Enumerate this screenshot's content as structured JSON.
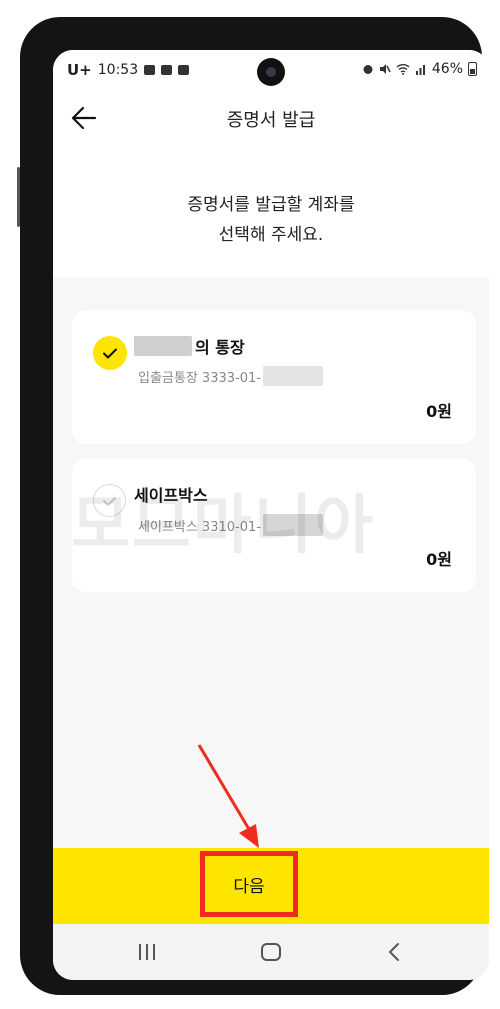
{
  "status_bar": {
    "carrier": "U+",
    "time": "10:53",
    "battery": "46%",
    "left_icons": [
      "gallery-icon",
      "message-icon",
      "message-icon"
    ],
    "right_icons": [
      "alarm-icon",
      "mute-icon",
      "wifi-icon",
      "signal-icon",
      "battery-icon"
    ]
  },
  "header": {
    "title": "증명서 발급",
    "back_icon": "arrow-left-icon"
  },
  "instruction": {
    "line1": "증명서를 발급할 계좌를",
    "line2": "선택해 주세요."
  },
  "accounts": [
    {
      "name_suffix": "의 통장",
      "account_prefix": "입출금통장 3333-01-",
      "balance": "0원",
      "selected": true
    },
    {
      "name": "세이프박스",
      "account_prefix": "세이프박스 3310-01-",
      "balance": "0원",
      "selected": false
    }
  ],
  "watermark": "모므마니아",
  "next_button": {
    "label": "다음"
  },
  "annotation": {
    "color": "#ee2b1e"
  },
  "nav_bar": {
    "icons": [
      "recent-apps-icon",
      "home-icon",
      "back-icon"
    ]
  },
  "colors": {
    "accent": "#fee500",
    "highlight": "#ee2b1e"
  }
}
